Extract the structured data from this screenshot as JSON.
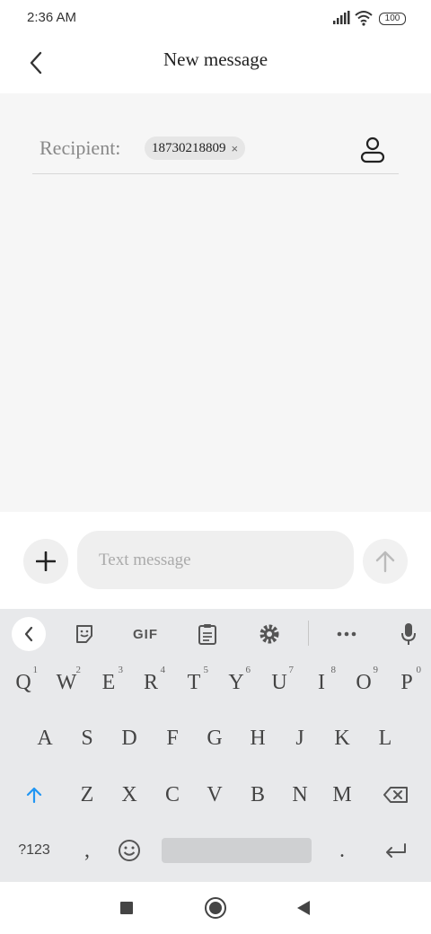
{
  "status_bar": {
    "time": "2:36 AM",
    "battery": "100"
  },
  "header": {
    "title": "New message"
  },
  "recipient": {
    "label": "Recipient:",
    "chip_value": "18730218809",
    "chip_remove": "×"
  },
  "composer": {
    "placeholder": "Text message"
  },
  "keyboard": {
    "toolbar": {
      "gif_label": "GIF"
    },
    "row1": [
      {
        "key": "Q",
        "hint": "1"
      },
      {
        "key": "W",
        "hint": "2"
      },
      {
        "key": "E",
        "hint": "3"
      },
      {
        "key": "R",
        "hint": "4"
      },
      {
        "key": "T",
        "hint": "5"
      },
      {
        "key": "Y",
        "hint": "6"
      },
      {
        "key": "U",
        "hint": "7"
      },
      {
        "key": "I",
        "hint": "8"
      },
      {
        "key": "O",
        "hint": "9"
      },
      {
        "key": "P",
        "hint": "0"
      }
    ],
    "row2": [
      "A",
      "S",
      "D",
      "F",
      "G",
      "H",
      "J",
      "K",
      "L"
    ],
    "row3": [
      "Z",
      "X",
      "C",
      "V",
      "B",
      "N",
      "M"
    ],
    "row4": {
      "symbols": "?123",
      "comma": ",",
      "period": "."
    }
  },
  "colors": {
    "accent": "#2196f3",
    "compose_bg": "#f6f6f6",
    "keyboard_bg": "#e8e9eb"
  }
}
